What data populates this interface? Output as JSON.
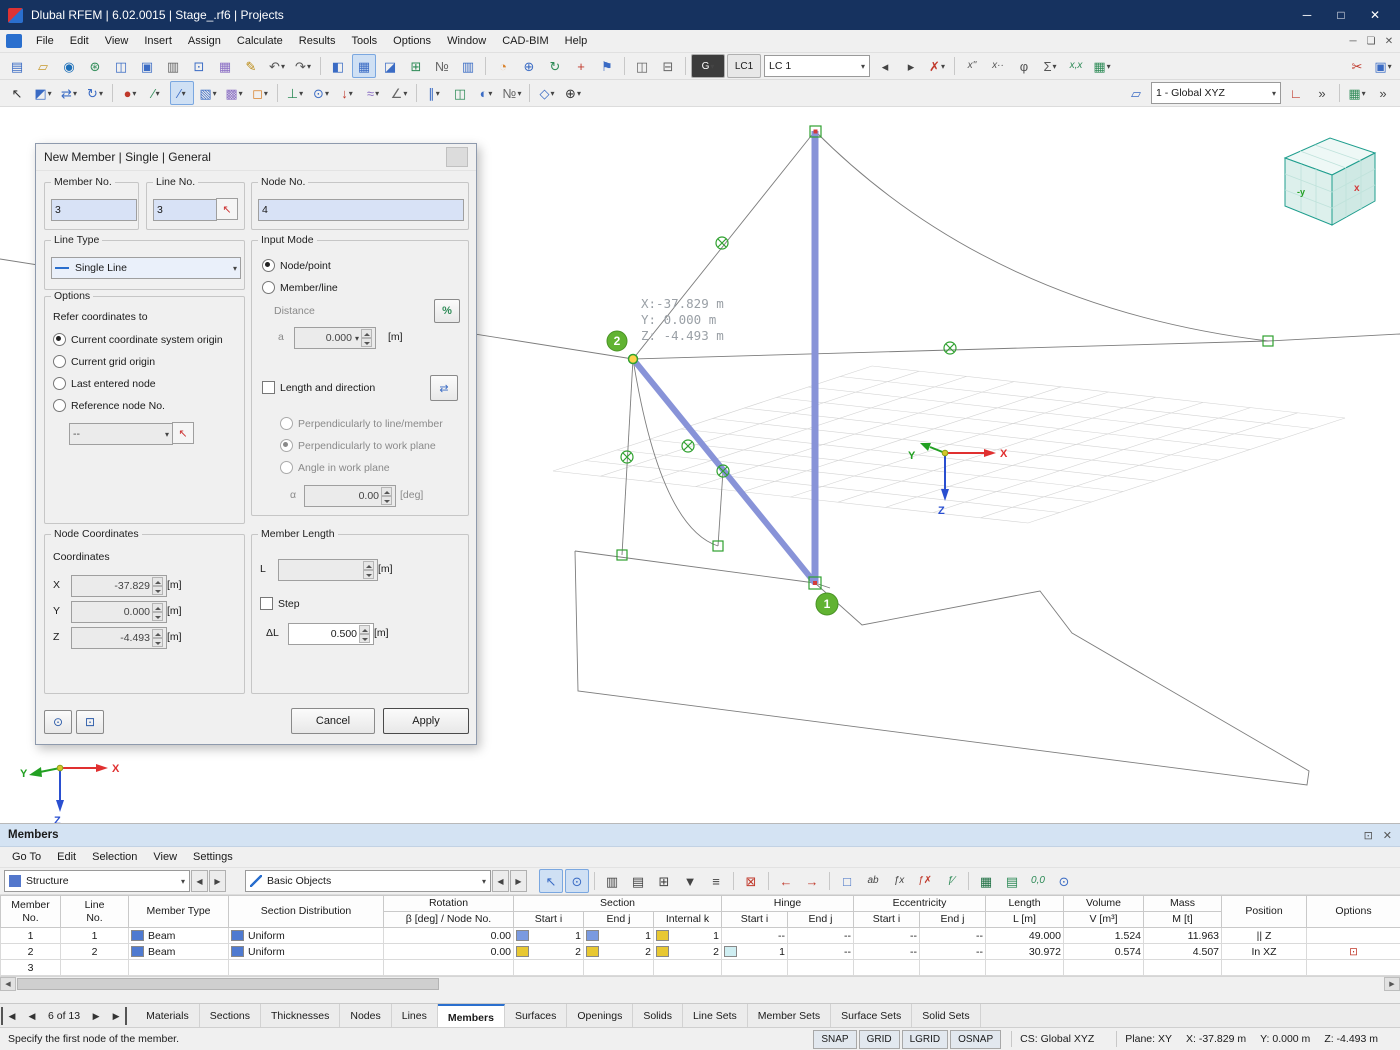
{
  "window": {
    "title": "Dlubal RFEM | 6.02.0015 | Stage_.rf6 | Projects",
    "min": "─",
    "max": "□",
    "close": "✕"
  },
  "menu": {
    "items": [
      "File",
      "Edit",
      "View",
      "Insert",
      "Assign",
      "Calculate",
      "Results",
      "Tools",
      "Options",
      "Window",
      "CAD-BIM",
      "Help"
    ],
    "mdi": [
      "─",
      "❏",
      "✕"
    ]
  },
  "toolbar1": {
    "icons": [
      {
        "n": "new-model",
        "g": "▤",
        "c": "#3a6bc4"
      },
      {
        "n": "open-model",
        "g": "▱",
        "c": "#c79a2e"
      },
      {
        "n": "dlubal-online",
        "g": "◉",
        "c": "#1d6fb8"
      },
      {
        "n": "webservice",
        "g": "⊛",
        "c": "#2e8b57"
      },
      {
        "n": "project-navigator",
        "g": "◫",
        "c": "#3a6bc4"
      },
      {
        "n": "save",
        "g": "▣",
        "c": "#3a6bc4"
      },
      {
        "n": "print",
        "g": "▥",
        "c": "#666"
      },
      {
        "n": "copy",
        "g": "⊡",
        "c": "#3a6bc4"
      },
      {
        "n": "templates",
        "g": "▦",
        "c": "#8a6ec4"
      },
      {
        "n": "comment",
        "g": "✎",
        "c": "#b8860b"
      },
      {
        "n": "undo",
        "g": "↶",
        "c": "#555",
        "caret": true
      },
      {
        "n": "redo",
        "g": "↷",
        "c": "#555",
        "caret": true
      },
      {
        "sep": true
      },
      {
        "n": "navigator-toggle",
        "g": "◧",
        "c": "#3a6bc4"
      },
      {
        "n": "tables-toggle",
        "g": "▦",
        "c": "#3a6bc4",
        "active": true
      },
      {
        "n": "result-diagrams",
        "g": "◪",
        "c": "#3a6bc4"
      },
      {
        "n": "export-table",
        "g": "⊞",
        "c": "#2e8b57"
      },
      {
        "n": "renumber",
        "g": "№",
        "c": "#666"
      },
      {
        "n": "table-view",
        "g": "▥",
        "c": "#3a6bc4"
      },
      {
        "sep": true
      },
      {
        "n": "protractor",
        "g": "◔",
        "c": "#d9822b"
      },
      {
        "n": "work-plane",
        "g": "⊕",
        "c": "#3a6bc4"
      },
      {
        "n": "rotate-view",
        "g": "↻",
        "c": "#2e8b57"
      },
      {
        "n": "snap-pointer",
        "g": "+",
        "c": "#c0392b"
      },
      {
        "n": "language",
        "g": "⚑",
        "c": "#3a6bc4"
      },
      {
        "sep": true
      },
      {
        "n": "split-view-1",
        "g": "◫",
        "c": "#666"
      },
      {
        "n": "split-view-2",
        "g": "⊟",
        "c": "#666"
      },
      {
        "sep": true
      },
      {
        "n": "load-case-type",
        "label": "G",
        "dark": true,
        "caret": true
      },
      {
        "n": "load-case-number",
        "label": "LC1"
      },
      {
        "n": "load-case",
        "label": "LC 1",
        "combo": true,
        "w": 96
      },
      {
        "n": "previous-load-case",
        "g": "◂",
        "c": "#444"
      },
      {
        "n": "next-load-case",
        "g": "▸",
        "c": "#444"
      },
      {
        "n": "delete-results",
        "g": "✗",
        "c": "#c0392b",
        "caret": true
      },
      {
        "sep": true
      },
      {
        "n": "calculate-x",
        "g": "x''",
        "c": "#555",
        "txt": true
      },
      {
        "n": "calculate-xdot",
        "g": "x··",
        "c": "#555",
        "txt": true
      },
      {
        "n": "calculate-phi",
        "g": "φ",
        "c": "#555"
      },
      {
        "n": "calculate-all",
        "g": "Σ",
        "c": "#555",
        "caret": true
      },
      {
        "n": "result-values",
        "g": "x,x",
        "c": "#2e8b57",
        "txt": true
      },
      {
        "n": "result-table",
        "g": "▦",
        "c": "#2e8b57",
        "caret": true
      },
      {
        "spacer": true
      },
      {
        "n": "cut-section",
        "g": "✂",
        "c": "#c0392b"
      },
      {
        "n": "render-mode",
        "g": "▣",
        "c": "#3a6bc4",
        "caret": true
      }
    ]
  },
  "toolbar2": {
    "icons": [
      {
        "n": "select",
        "g": "↖",
        "c": "#333"
      },
      {
        "n": "select-special",
        "g": "◩",
        "c": "#3a6bc4",
        "caret": true
      },
      {
        "n": "move-copy",
        "g": "⇄",
        "c": "#3a6bc4",
        "caret": true
      },
      {
        "n": "edit-rotate",
        "g": "↻",
        "c": "#3a6bc4",
        "caret": true
      },
      {
        "sep": true
      },
      {
        "n": "new-node",
        "g": "●",
        "c": "#c0392b",
        "caret": true
      },
      {
        "n": "new-line",
        "g": "∕",
        "c": "#2e8b57",
        "caret": true
      },
      {
        "n": "new-member",
        "g": "∕",
        "c": "#3a6bc4",
        "active": true,
        "caret": true
      },
      {
        "n": "new-surface",
        "g": "▧",
        "c": "#3a6bc4",
        "caret": true
      },
      {
        "n": "new-solid",
        "g": "▩",
        "c": "#8a6ec4",
        "caret": true
      },
      {
        "n": "new-opening",
        "g": "◻",
        "c": "#d9822b",
        "caret": true
      },
      {
        "sep": true
      },
      {
        "n": "new-support",
        "g": "⊥",
        "c": "#2e8b57",
        "caret": true
      },
      {
        "n": "new-hinge",
        "g": "⊙",
        "c": "#3a6bc4",
        "caret": true
      },
      {
        "n": "new-load",
        "g": "↓",
        "c": "#c0392b",
        "caret": true
      },
      {
        "n": "new-imperfection",
        "g": "≈",
        "c": "#8a6ec4",
        "caret": true
      },
      {
        "n": "new-dimension",
        "g": "∠",
        "c": "#666",
        "caret": true
      },
      {
        "sep": true
      },
      {
        "n": "guidelines",
        "g": "∥",
        "c": "#3a6bc4",
        "caret": true
      },
      {
        "n": "section-view",
        "g": "◫",
        "c": "#2e8b57"
      },
      {
        "n": "visibility",
        "g": "◐",
        "c": "#3a6bc4",
        "caret": true
      },
      {
        "n": "numbering",
        "g": "№",
        "c": "#666",
        "caret": true
      },
      {
        "sep": true
      },
      {
        "n": "isometric-view",
        "g": "◇",
        "c": "#3a6bc4",
        "caret": true
      },
      {
        "n": "zoom",
        "g": "⊕",
        "c": "#333",
        "caret": true
      },
      {
        "spacer": true
      },
      {
        "n": "work-plane-select",
        "g": "▱",
        "c": "#3a6bc4"
      },
      {
        "n": "coordinate-system",
        "label": "1 - Global XYZ",
        "combo": true,
        "w": 120
      },
      {
        "n": "plane-axes",
        "g": "∟",
        "c": "#c0392b"
      },
      {
        "n": "overflow-left",
        "g": "»",
        "c": "#444"
      },
      {
        "sep": true
      },
      {
        "n": "grid-settings",
        "g": "▦",
        "c": "#2e8b57",
        "caret": true
      },
      {
        "n": "overflow-right",
        "g": "»",
        "c": "#444"
      }
    ]
  },
  "dialog": {
    "title": "New Member | Single | General",
    "member_no": {
      "label": "Member No.",
      "value": "3"
    },
    "line_no": {
      "label": "Line No.",
      "value": "3",
      "pick": "↖"
    },
    "node_no": {
      "label": "Node No.",
      "value": "4"
    },
    "line_type": {
      "label": "Line Type",
      "value": "Single Line"
    },
    "options": {
      "label": "Options",
      "refer_label": "Refer coordinates to",
      "r1": "Current coordinate system origin",
      "r2": "Current grid origin",
      "r3": "Last entered node",
      "r4": "Reference node No.",
      "ref_value": "--",
      "pick": "↖"
    },
    "input_mode": {
      "label": "Input Mode",
      "radio_node": "Node/point",
      "radio_member": "Member/line",
      "distance_label": "Distance",
      "percent": "%",
      "a_label": "a",
      "a_value": "0.000",
      "a_unit": "[m]",
      "length_dir": "Length and direction",
      "expand": "⇄",
      "perp_line": "Perpendicularly to line/member",
      "perp_plane": "Perpendicularly to work plane",
      "angle_plane": "Angle in work plane",
      "alpha_label": "α",
      "alpha_value": "0.00",
      "alpha_unit": "[deg]"
    },
    "node_coordinates": {
      "label": "Node Coordinates",
      "coords_label": "Coordinates",
      "x_label": "X",
      "x_value": "-37.829",
      "y_label": "Y",
      "y_value": "0.000",
      "z_label": "Z",
      "z_value": "-4.493",
      "unit": "[m]"
    },
    "member_length": {
      "label": "Member Length",
      "l_label": "L",
      "l_value": "",
      "l_unit": "[m]",
      "step": "Step",
      "dl_label": "ΔL",
      "dl_value": "0.500",
      "dl_unit": "[m]"
    },
    "find_icon": "⊙",
    "window_icon": "⊡",
    "cancel": "Cancel",
    "apply": "Apply"
  },
  "viewport": {
    "tooltip_x": "X:-37.829 m",
    "tooltip_y": "Y:  0.000 m",
    "tooltip_z": "Z: -4.493 m",
    "badge_1": "1",
    "badge_2": "2",
    "axis_x": "X",
    "axis_y": "Y",
    "axis_z": "Z",
    "cube_x": "x",
    "cube_y": "-y",
    "accent_member": "#8893d8",
    "accent_node": "#61b332"
  },
  "members_panel": {
    "title": "Members",
    "float_icon": "⊡",
    "close_icon": "✕",
    "menu": [
      "Go To",
      "Edit",
      "Selection",
      "View",
      "Settings"
    ],
    "structure_combo": "Structure",
    "objects_combo": "Basic Objects",
    "toolbar_icons": [
      {
        "n": "select-in-graphic",
        "g": "↖",
        "c": "#3a6bc4",
        "active": true
      },
      {
        "n": "sync-selection",
        "g": "⊙",
        "c": "#3a6bc4",
        "active": true
      },
      {
        "sep": true
      },
      {
        "n": "table-columns",
        "g": "▥",
        "c": "#444"
      },
      {
        "n": "print-table",
        "g": "▤",
        "c": "#444"
      },
      {
        "n": "insert-row",
        "g": "⊞",
        "c": "#444"
      },
      {
        "n": "filter-rows",
        "g": "▼",
        "c": "#444"
      },
      {
        "n": "table-settings",
        "g": "≡",
        "c": "#444"
      },
      {
        "sep": true
      },
      {
        "n": "delete-row",
        "g": "⊠",
        "c": "#c0392b"
      },
      {
        "sep": true
      },
      {
        "n": "import-row",
        "g": "←",
        "c": "#c0392b"
      },
      {
        "n": "export-row",
        "g": "→",
        "c": "#c0392b"
      },
      {
        "sep": true
      },
      {
        "n": "empty-cells",
        "g": "□",
        "c": "#3a6bc4"
      },
      {
        "n": "rename-cell",
        "g": "ab",
        "c": "#444",
        "txt": true
      },
      {
        "n": "formula",
        "g": "ƒx",
        "c": "#444",
        "txt": true
      },
      {
        "n": "formula-check",
        "g": "ƒ✗",
        "c": "#c0392b",
        "txt": true
      },
      {
        "n": "formula-edit",
        "g": "ƒ∕",
        "c": "#2e8b57",
        "txt": true
      },
      {
        "sep": true
      },
      {
        "n": "excel-export",
        "g": "▦",
        "c": "#1d6f42"
      },
      {
        "n": "ole-link",
        "g": "▤",
        "c": "#2e8b57"
      },
      {
        "n": "decimal-places",
        "g": "0,0",
        "c": "#2e8b57",
        "txt": true
      },
      {
        "n": "table-help",
        "g": "⊙",
        "c": "#3a6bc4"
      }
    ],
    "table": {
      "h_member1": "Member",
      "h_member2": "No.",
      "h_line1": "Line",
      "h_line2": "No.",
      "h_type": "Member Type",
      "h_dist": "Section Distribution",
      "h_rot1": "Rotation",
      "h_rot2": "β [deg] / Node No.",
      "h_section": "Section",
      "h_start": "Start i",
      "h_end": "End j",
      "h_internal": "Internal k",
      "h_hinge": "Hinge",
      "h_ecc": "Eccentricity",
      "h_len1": "Length",
      "h_len2": "L [m]",
      "h_vol1": "Volume",
      "h_vol2": "V [m³]",
      "h_mass1": "Mass",
      "h_mass2": "M [t]",
      "h_pos": "Position",
      "h_opt": "Options",
      "rows": [
        {
          "no": "1",
          "line": "1",
          "type": "Beam",
          "type_c": "#4f7ad0",
          "dist": "Uniform",
          "dist_c": "#4f7ad0",
          "rot": "0.00",
          "sec_i": {
            "c": "#7a9ae0",
            "v": "1"
          },
          "sec_j": {
            "c": "#7a9ae0",
            "v": "1"
          },
          "sec_k": {
            "c": "#e8c832",
            "v": "1"
          },
          "hin_i": {
            "v": "--"
          },
          "hin_j": {
            "v": "--"
          },
          "ecc_i": {
            "v": "--"
          },
          "ecc_j": {
            "v": "--"
          },
          "len": "49.000",
          "vol": "1.524",
          "mass": "11.963",
          "pos": "|| Z",
          "opt": ""
        },
        {
          "no": "2",
          "line": "2",
          "type": "Beam",
          "type_c": "#4f7ad0",
          "dist": "Uniform",
          "dist_c": "#4f7ad0",
          "rot": "0.00",
          "sec_i": {
            "c": "#e8c832",
            "v": "2"
          },
          "sec_j": {
            "c": "#e8c832",
            "v": "2"
          },
          "sec_k": {
            "c": "#e8c832",
            "v": "2"
          },
          "hin_i": {
            "c": "#cfeef2",
            "v": "1"
          },
          "hin_j": {
            "v": "--"
          },
          "ecc_i": {
            "v": "--"
          },
          "ecc_j": {
            "v": "--"
          },
          "len": "30.972",
          "vol": "0.574",
          "mass": "4.507",
          "pos": "In XZ",
          "opt": "⊡"
        },
        {
          "no": "3",
          "line": "",
          "type": "",
          "dist": "",
          "rot": "",
          "sec_i": null,
          "sec_j": null,
          "sec_k": null,
          "hin_i": null,
          "hin_j": null,
          "ecc_i": null,
          "ecc_j": null,
          "len": "",
          "vol": "",
          "mass": "",
          "pos": "",
          "opt": ""
        }
      ]
    },
    "nav_first": "◀",
    "nav_prev": "◀",
    "nav_count": "6 of 13",
    "nav_next": "▶",
    "nav_last": "▶",
    "tabs": [
      "Materials",
      "Sections",
      "Thicknesses",
      "Nodes",
      "Lines",
      "Members",
      "Surfaces",
      "Openings",
      "Solids",
      "Line Sets",
      "Member Sets",
      "Surface Sets",
      "Solid Sets"
    ],
    "active_tab": "Members"
  },
  "statusbar": {
    "hint": "Specify the first node of the member.",
    "toggles": [
      "SNAP",
      "GRID",
      "LGRID",
      "OSNAP"
    ],
    "cs": "CS: Global XYZ",
    "plane": "Plane: XY",
    "x": "X: -37.829 m",
    "y": "Y: 0.000 m",
    "z": "Z: -4.493 m"
  }
}
